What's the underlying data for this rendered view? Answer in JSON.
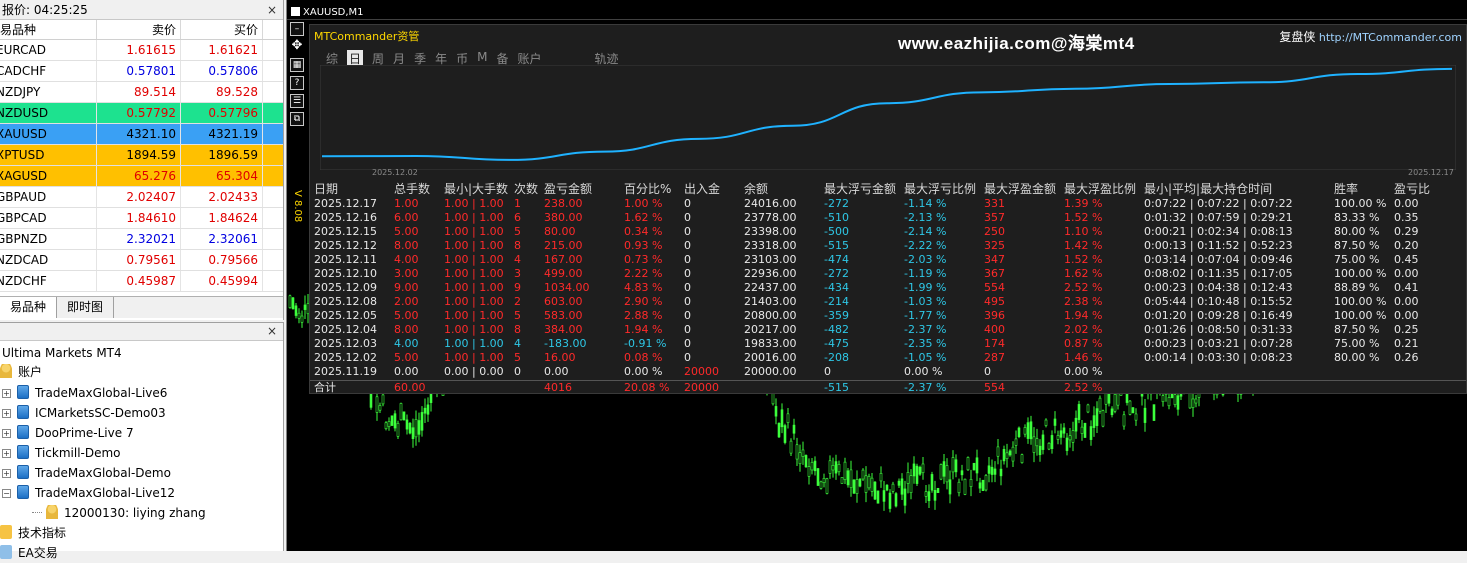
{
  "market_watch": {
    "title": "报价: 04:25:25",
    "columns": [
      "易品种",
      "卖价",
      "买价"
    ],
    "rows": [
      {
        "symbol": "EURCAD",
        "bid": "1.61615",
        "ask": "1.61621",
        "color": "#e00000",
        "bg": "#ffffff"
      },
      {
        "symbol": "CADCHF",
        "bid": "0.57801",
        "ask": "0.57806",
        "color": "#0000e0",
        "bg": "#ffffff"
      },
      {
        "symbol": "NZDJPY",
        "bid": "89.514",
        "ask": "89.528",
        "color": "#e00000",
        "bg": "#ffffff"
      },
      {
        "symbol": "NZDUSD",
        "bid": "0.57792",
        "ask": "0.57796",
        "color": "#e00000",
        "bg": "#1de28f"
      },
      {
        "symbol": "XAUUSD",
        "bid": "4321.10",
        "ask": "4321.19",
        "color": "#000000",
        "bg": "#3aa0f4"
      },
      {
        "symbol": "XPTUSD",
        "bid": "1894.59",
        "ask": "1896.59",
        "color": "#000000",
        "bg": "#ffc000"
      },
      {
        "symbol": "XAGUSD",
        "bid": "65.276",
        "ask": "65.304",
        "color": "#e00000",
        "bg": "#ffc000"
      },
      {
        "symbol": "GBPAUD",
        "bid": "2.02407",
        "ask": "2.02433",
        "color": "#e00000",
        "bg": "#ffffff"
      },
      {
        "symbol": "GBPCAD",
        "bid": "1.84610",
        "ask": "1.84624",
        "color": "#e00000",
        "bg": "#ffffff"
      },
      {
        "symbol": "GBPNZD",
        "bid": "2.32021",
        "ask": "2.32061",
        "color": "#0000e0",
        "bg": "#ffffff"
      },
      {
        "symbol": "NZDCAD",
        "bid": "0.79561",
        "ask": "0.79566",
        "color": "#e00000",
        "bg": "#ffffff"
      },
      {
        "symbol": "NZDCHF",
        "bid": "0.45987",
        "ask": "0.45994",
        "color": "#e00000",
        "bg": "#ffffff"
      }
    ],
    "tabs": [
      "易品种",
      "即时图"
    ]
  },
  "navigator": {
    "root": "Ultima Markets MT4",
    "accounts_label": "账户",
    "accounts": [
      "TradeMaxGlobal-Live6",
      "ICMarketsSC-Demo03",
      "DooPrime-Live 7",
      "Tickmill-Demo",
      "TradeMaxGlobal-Demo",
      "TradeMaxGlobal-Live12"
    ],
    "user": "12000130: liying zhang",
    "indicators": "技术指标",
    "experts": "EA交易"
  },
  "chart": {
    "title": "XAUUSD,M1",
    "version_label": "V 8.08"
  },
  "panel": {
    "brand": "MTCommander资管",
    "watermark": "www.eazhijia.com@海棠mt4",
    "brand_right_cn": "复盘侠",
    "brand_right_url": "http://MTCommander.com",
    "tabs": [
      "综",
      "日",
      "周",
      "月",
      "季",
      "年",
      "币",
      "M",
      "备",
      "账户",
      "轨迹"
    ],
    "active_tab": "日",
    "curve_start_label": "2025.12.02",
    "curve_end_label": "2025.12.17",
    "table": {
      "headers": [
        "日期",
        "总手数",
        "最小|大手数",
        "次数",
        "盈亏金额",
        "百分比%",
        "出入金",
        "余额",
        "最大浮亏金额",
        "最大浮亏比例",
        "最大浮盈金额",
        "最大浮盈比例",
        "最小|平均|最大持仓时间",
        "胜率",
        "盈亏比"
      ],
      "rows": [
        [
          "2025.12.17",
          "1.00",
          "1.00 | 1.00",
          "1",
          "238.00",
          "1.00 %",
          "0",
          "24016.00",
          "-272",
          "-1.14 %",
          "331",
          "1.39 %",
          "0:07:22 | 0:07:22 | 0:07:22",
          "100.00 %",
          "0.00"
        ],
        [
          "2025.12.16",
          "6.00",
          "1.00 | 1.00",
          "6",
          "380.00",
          "1.62 %",
          "0",
          "23778.00",
          "-510",
          "-2.13 %",
          "357",
          "1.52 %",
          "0:01:32 | 0:07:59 | 0:29:21",
          "83.33 %",
          "0.35"
        ],
        [
          "2025.12.15",
          "5.00",
          "1.00 | 1.00",
          "5",
          "80.00",
          "0.34 %",
          "0",
          "23398.00",
          "-500",
          "-2.14 %",
          "250",
          "1.10 %",
          "0:00:21 | 0:02:34 | 0:08:13",
          "80.00 %",
          "0.29"
        ],
        [
          "2025.12.12",
          "8.00",
          "1.00 | 1.00",
          "8",
          "215.00",
          "0.93 %",
          "0",
          "23318.00",
          "-515",
          "-2.22 %",
          "325",
          "1.42 %",
          "0:00:13 | 0:11:52 | 0:52:23",
          "87.50 %",
          "0.20"
        ],
        [
          "2025.12.11",
          "4.00",
          "1.00 | 1.00",
          "4",
          "167.00",
          "0.73 %",
          "0",
          "23103.00",
          "-474",
          "-2.03 %",
          "347",
          "1.52 %",
          "0:03:14 | 0:07:04 | 0:09:46",
          "75.00 %",
          "0.45"
        ],
        [
          "2025.12.10",
          "3.00",
          "1.00 | 1.00",
          "3",
          "499.00",
          "2.22 %",
          "0",
          "22936.00",
          "-272",
          "-1.19 %",
          "367",
          "1.62 %",
          "0:08:02 | 0:11:35 | 0:17:05",
          "100.00 %",
          "0.00"
        ],
        [
          "2025.12.09",
          "9.00",
          "1.00 | 1.00",
          "9",
          "1034.00",
          "4.83 %",
          "0",
          "22437.00",
          "-434",
          "-1.99 %",
          "554",
          "2.52 %",
          "0:00:23 | 0:04:38 | 0:12:43",
          "88.89 %",
          "0.41"
        ],
        [
          "2025.12.08",
          "2.00",
          "1.00 | 1.00",
          "2",
          "603.00",
          "2.90 %",
          "0",
          "21403.00",
          "-214",
          "-1.03 %",
          "495",
          "2.38 %",
          "0:05:44 | 0:10:48 | 0:15:52",
          "100.00 %",
          "0.00"
        ],
        [
          "2025.12.05",
          "5.00",
          "1.00 | 1.00",
          "5",
          "583.00",
          "2.88 %",
          "0",
          "20800.00",
          "-359",
          "-1.77 %",
          "396",
          "1.94 %",
          "0:01:20 | 0:09:28 | 0:16:49",
          "100.00 %",
          "0.00"
        ],
        [
          "2025.12.04",
          "8.00",
          "1.00 | 1.00",
          "8",
          "384.00",
          "1.94 %",
          "0",
          "20217.00",
          "-482",
          "-2.37 %",
          "400",
          "2.02 %",
          "0:01:26 | 0:08:50 | 0:31:33",
          "87.50 %",
          "0.25"
        ],
        [
          "2025.12.03",
          "4.00",
          "1.00 | 1.00",
          "4",
          "-183.00",
          "-0.91 %",
          "0",
          "19833.00",
          "-475",
          "-2.35 %",
          "174",
          "0.87 %",
          "0:00:23 | 0:03:21 | 0:07:28",
          "75.00 %",
          "0.21"
        ],
        [
          "2025.12.02",
          "5.00",
          "1.00 | 1.00",
          "5",
          "16.00",
          "0.08 %",
          "0",
          "20016.00",
          "-208",
          "-1.05 %",
          "287",
          "1.46 %",
          "0:00:14 | 0:03:30 | 0:08:23",
          "80.00 %",
          "0.26"
        ],
        [
          "2025.11.19",
          "0.00",
          "0.00 | 0.00",
          "0",
          "0.00",
          "0.00 %",
          "20000",
          "20000.00",
          "0",
          "0.00 %",
          "0",
          "0.00 %",
          "",
          "",
          ""
        ]
      ],
      "total": [
        "合计",
        "60.00",
        "",
        "",
        "4016",
        "20.08 %",
        "20000",
        "",
        "-515",
        "-2.37 %",
        "554",
        "2.52 %",
        "",
        "",
        ""
      ]
    }
  },
  "colors": {
    "red": "#ff2a2a",
    "cyan": "#2ec7e6",
    "white": "#e8e8e8",
    "orange": "#ff8c1a",
    "curve": "#1fb2ff",
    "candle_green": "#3dff3d"
  }
}
